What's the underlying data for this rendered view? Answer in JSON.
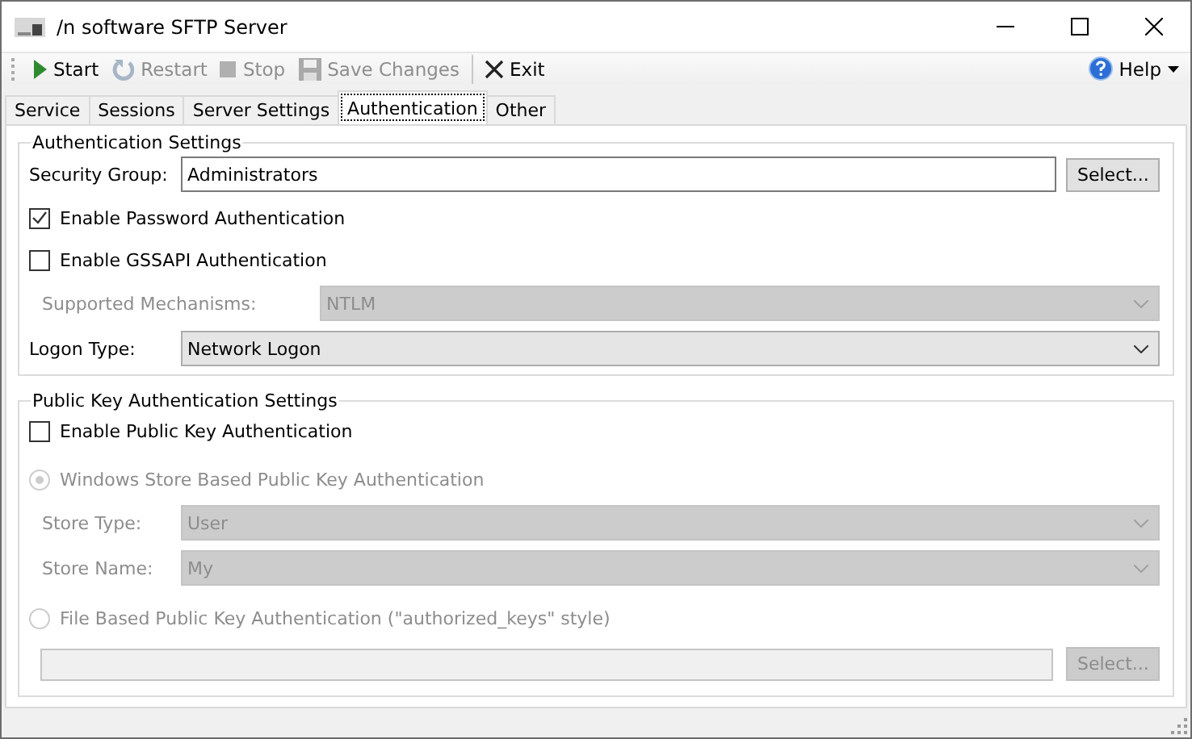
{
  "window": {
    "title": "/n software SFTP Server"
  },
  "toolbar": {
    "buttons": [
      {
        "kind": "start",
        "label": "Start",
        "disabled": false
      },
      {
        "kind": "restart",
        "label": "Restart",
        "disabled": true
      },
      {
        "kind": "stop",
        "label": "Stop",
        "disabled": true
      },
      {
        "kind": "save",
        "label": "Save Changes",
        "disabled": true
      },
      {
        "kind": "exit",
        "label": "Exit",
        "disabled": false
      }
    ],
    "help": {
      "label": "Help"
    }
  },
  "tabs": [
    {
      "label": "Service",
      "selected": false
    },
    {
      "label": "Sessions",
      "selected": false
    },
    {
      "label": "Server Settings",
      "selected": false
    },
    {
      "label": "Authentication",
      "selected": true
    },
    {
      "label": "Other",
      "selected": false
    }
  ],
  "auth": {
    "title": "Authentication Settings",
    "security_group": {
      "label": "Security Group:",
      "value": "Administrators",
      "button": "Select..."
    },
    "checkboxes": [
      {
        "label": "Enable Password Authentication",
        "checked": true
      },
      {
        "label": "Enable GSSAPI Authentication",
        "checked": false
      }
    ],
    "mechanisms": {
      "label": "Supported Mechanisms:",
      "value": "NTLM",
      "disabled": true
    },
    "logon_type": {
      "label": "Logon Type:",
      "value": "Network Logon",
      "disabled": false
    }
  },
  "public_key": {
    "title": "Public Key Authentication Settings",
    "enable": {
      "label": "Enable Public Key Authentication",
      "checked": false
    },
    "windows_store": {
      "label": "Windows Store Based Public Key Authentication",
      "selected": true,
      "disabled": true
    },
    "store_type": {
      "label": "Store Type:",
      "value": "User",
      "disabled": true
    },
    "store_name": {
      "label": "Store Name:",
      "value": "My",
      "disabled": true
    },
    "file_based": {
      "label": "File Based Public Key Authentication (\"authorized_keys\" style)",
      "selected": false,
      "disabled": true
    },
    "path_field": {
      "disabled": true
    },
    "button": {
      "label": "Select...",
      "disabled": true
    }
  }
}
